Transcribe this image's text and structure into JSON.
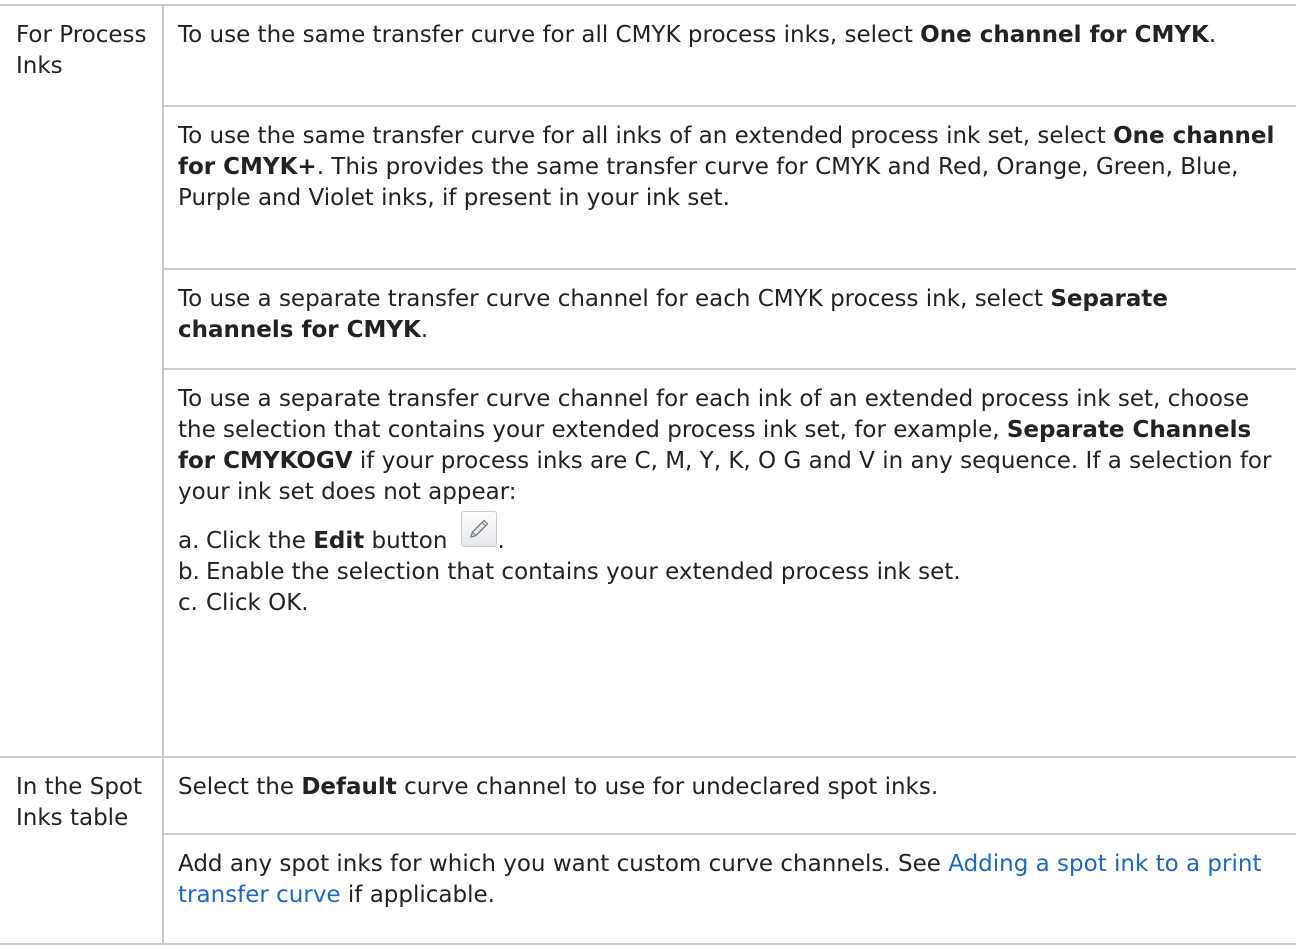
{
  "rows": {
    "process_label": "For Process Inks",
    "spot_label": "In the Spot Inks table",
    "r1": {
      "pre": "To use the same transfer curve for all CMYK process inks, select ",
      "bold": "One channel for CMYK",
      "post": "."
    },
    "r2": {
      "pre": "To use the same transfer curve for all inks of an extended process ink set, select ",
      "bold": "One channel for CMYK+",
      "post": ". This provides the same transfer curve for CMYK and Red, Orange, Green, Blue, Purple and Violet inks, if present in your ink set."
    },
    "r3": {
      "pre": "To use a separate transfer curve channel for each CMYK process ink, select ",
      "bold": "Separate channels for CMYK",
      "post": "."
    },
    "r4": {
      "pre": "To use a separate transfer curve channel for each ink of an extended process ink set, choose the selection that contains your extended process ink set, for example, ",
      "bold": "Separate Channels for CMYKOGV",
      "post": " if your process inks are C, M, Y, K, O G and V in any sequence. If a selection for your ink set does not appear:",
      "steps": {
        "a_letter": "a.",
        "a_pre": "Click the ",
        "a_bold": "Edit",
        "a_post": " button",
        "a_end": ".",
        "b_letter": "b.",
        "b_text": "Enable the selection that contains your extended process ink set.",
        "c_letter": "c.",
        "c_text": "Click OK."
      }
    },
    "r5": {
      "pre": "Select the ",
      "bold": "Default",
      "post": " curve channel to use for undeclared spot inks."
    },
    "r6": {
      "pre": "Add any spot inks for which you want custom curve channels. See ",
      "link": "Adding a spot ink to a print transfer curve",
      "post": " if applicable."
    }
  },
  "icons": {
    "edit": "pencil-icon"
  },
  "colors": {
    "link": "#1a67c5",
    "border": "#c9ccd3",
    "text": "#222222"
  }
}
